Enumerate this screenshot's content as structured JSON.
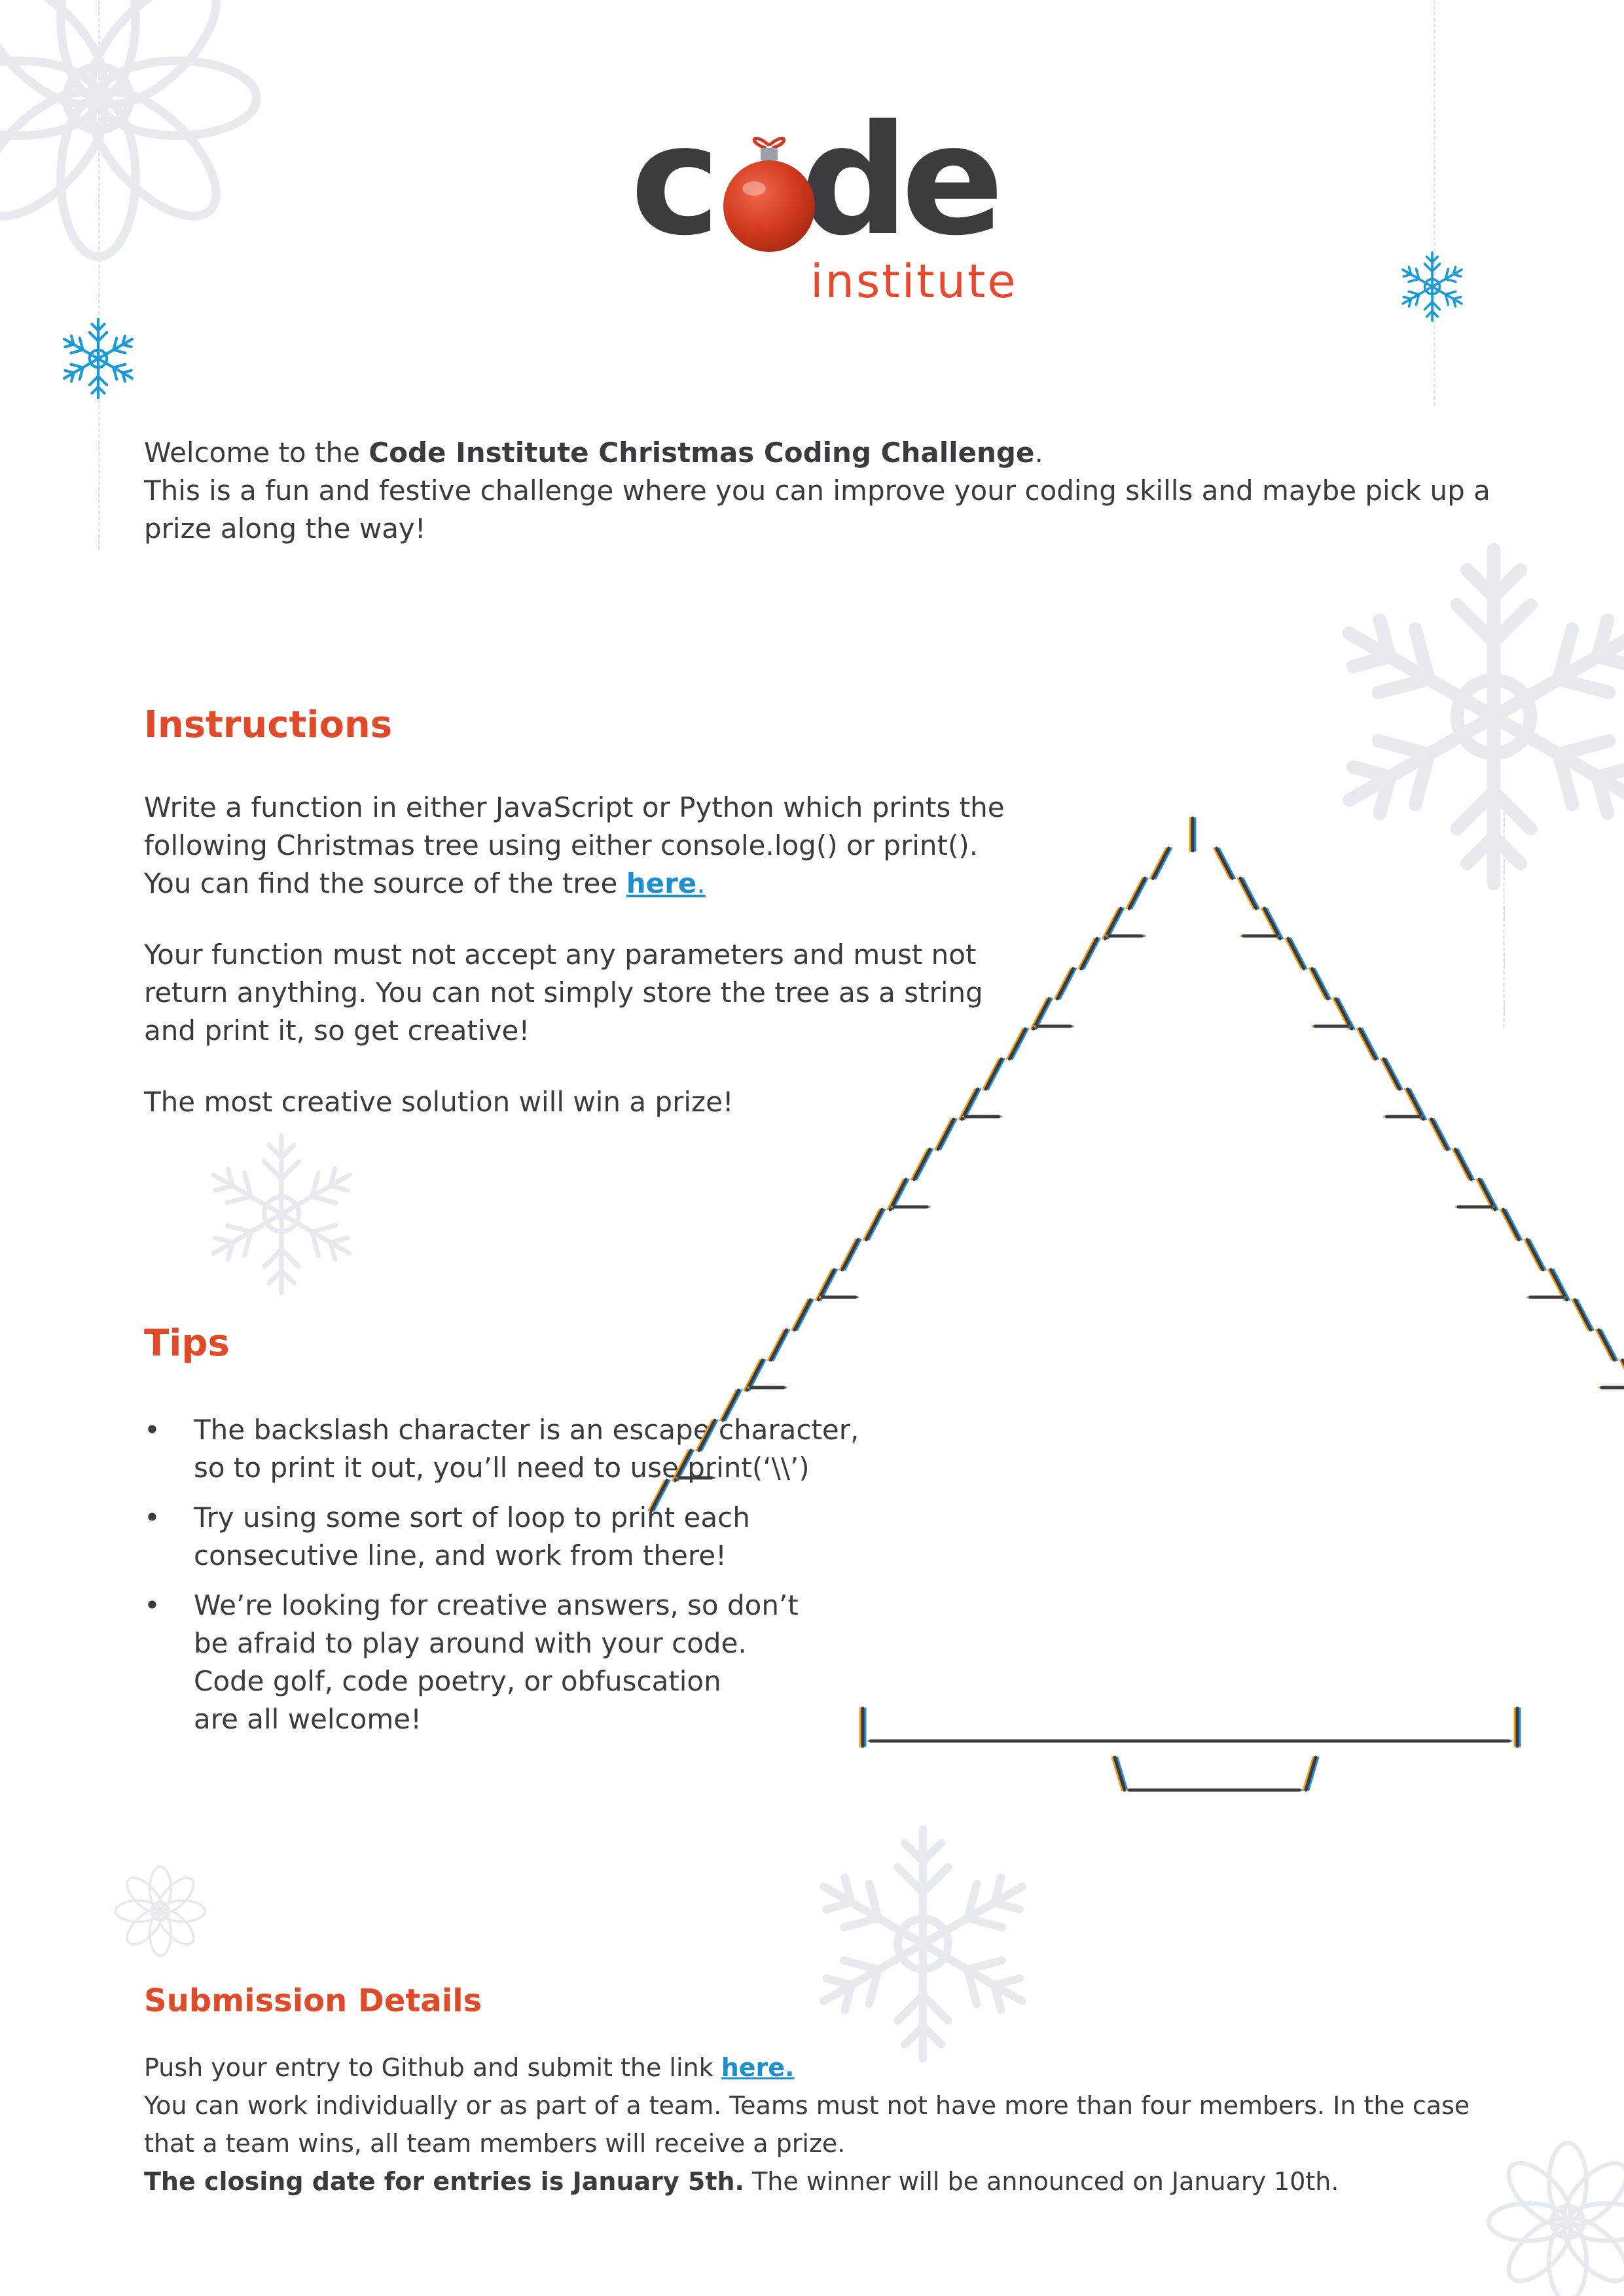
{
  "logo": {
    "word": "code",
    "word_before": "c",
    "word_after": "de",
    "subtitle": "institute",
    "accent": "#e6492d",
    "bauble_color": "#d23a1e",
    "icons": [
      "bauble-icon"
    ]
  },
  "intro": {
    "prefix": "Welcome to the ",
    "strong": "Code Institute Christmas Coding Challenge",
    "suffix": ".",
    "line2": "This is a fun and festive challenge where you can improve your coding skills and maybe pick up a",
    "line3": "prize along the way!"
  },
  "instructions": {
    "heading": "Instructions",
    "p1_line1": "Write a function in either JavaScript or Python which prints the",
    "p1_line2": "following Christmas tree using either console.log() or print().",
    "p1_line3_prefix": "You can find the source of the tree ",
    "p1_link": "here",
    "p1_link_suffix": ".",
    "p2_line1": "Your function must not accept any parameters and must not",
    "p2_line2": "return anything. You can not simply store the tree as a string",
    "p2_line3": "and print it, so get creative!",
    "p3": "The most creative solution will win a prize!"
  },
  "tips": {
    "heading": "Tips",
    "bullet": "•",
    "items": [
      {
        "line1": "The backslash character is an escape character,",
        "line2": "so to print it out, you’ll need to use print(‘\\\\’)"
      },
      {
        "line1": "Try using some sort of loop to print each",
        "line2": "consecutive line, and work from there!"
      },
      {
        "line1": "We’re looking for creative answers, so don’t",
        "line2": "be afraid to play around with your code.",
        "line3": "Code golf, code poetry, or obfuscation",
        "line4": "are all welcome!"
      }
    ]
  },
  "submission": {
    "heading": "Submission Details",
    "line1_prefix": "Push your entry to Github and submit the link ",
    "line1_link": "here.",
    "line2": "You can work individually or as part of a team. Teams must not have more than four members. In the case",
    "line3": "that a team wins, all team members will receive a prize.",
    "line4_strong": "The closing date for entries is January 5th.",
    "line4_rest": " The winner will be announced on January 10th."
  },
  "tree": {
    "type": "ascii-art",
    "rows": 26,
    "ink_color": "#3b3c40",
    "shadow_left": "#f0a020",
    "shadow_right": "#2a8fd0",
    "icons": [
      "christmas-tree-icon"
    ]
  },
  "decor": {
    "snowflake_grey": "#e6e9ed",
    "snowflake_blue": "#1a9ad6",
    "icons": [
      "snowflake-icon"
    ]
  }
}
